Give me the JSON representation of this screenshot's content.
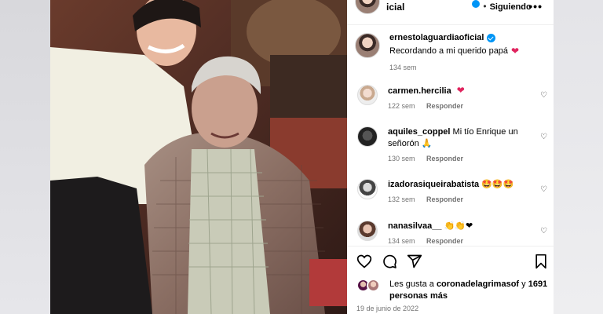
{
  "post": {
    "header": {
      "username_partial": "icial",
      "separator": "•",
      "follow_status": "Siguiendo",
      "more": "•••"
    },
    "caption": {
      "username": "ernestolaguardiaoficial",
      "text": "Recordando a mi querido papá",
      "heart": "❤",
      "time": "134 sem"
    },
    "comments": [
      {
        "username": "carmen.hercilia",
        "text": "",
        "emoji": "❤",
        "time": "122 sem",
        "reply": "Responder"
      },
      {
        "username": "aquiles_coppel",
        "text": "Mi tío Enrique un señorón 🙏",
        "emoji": "",
        "time": "130 sem",
        "reply": "Responder"
      },
      {
        "username": "izadorasiqueirabatista",
        "text": "",
        "emoji": "🤩🤩🤩",
        "time": "132 sem",
        "reply": "Responder"
      },
      {
        "username": "nanasilvaa__",
        "text": "",
        "emoji": "👏👏❤",
        "time": "134 sem",
        "reply": "Responder"
      }
    ],
    "likes": {
      "prefix": "Les gusta a ",
      "user": "coronadelagrimasof",
      "middle": " y ",
      "count": "1691",
      "suffix": "personas más"
    },
    "date": "19 de junio de 2022"
  },
  "icons": [
    "heart-icon",
    "comment-icon",
    "share-icon",
    "bookmark-icon",
    "verified-icon",
    "more-icon"
  ],
  "colors": {
    "verified": "#0095f6",
    "heart": "#e0245e",
    "muted": "#737373"
  }
}
